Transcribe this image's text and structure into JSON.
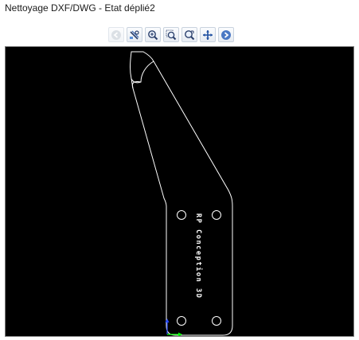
{
  "window": {
    "title": "Nettoyage DXF/DWG - Etat déplié2"
  },
  "toolbar": {
    "buttons": [
      {
        "name": "back-button",
        "icon": "back-arrow-icon",
        "enabled": false
      },
      {
        "name": "clean-tool-button",
        "icon": "clean-tool-icon",
        "enabled": true
      },
      {
        "name": "zoom-in-button",
        "icon": "zoom-in-icon",
        "enabled": true
      },
      {
        "name": "zoom-window-button",
        "icon": "zoom-window-icon",
        "enabled": true
      },
      {
        "name": "zoom-fit-button",
        "icon": "zoom-fit-icon",
        "enabled": true
      },
      {
        "name": "pan-button",
        "icon": "pan-move-icon",
        "enabled": true
      },
      {
        "name": "next-button",
        "icon": "forward-arrow-icon",
        "enabled": true
      }
    ]
  },
  "drawing": {
    "background_color": "#000000",
    "line_color": "#ffffff",
    "engraved_text": "RP Conception 3D",
    "axis_x_color": "#00ff00",
    "axis_y_color": "#2a4dff"
  }
}
